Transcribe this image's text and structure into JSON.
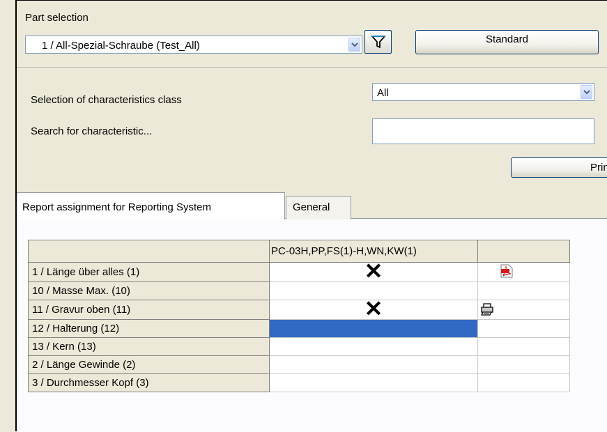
{
  "part_selection": {
    "label": "Part selection",
    "value": "1 / All-Spezial-Schraube (Test_All)",
    "standard_button": "Standard"
  },
  "filters": {
    "class_label": "Selection of characteristics class",
    "class_value": "All",
    "search_label": "Search for characteristic...",
    "search_value": "",
    "print_button": "Prin"
  },
  "tabs": [
    {
      "label": "Report assignment for Reporting System",
      "active": true
    },
    {
      "label": "General",
      "active": false
    }
  ],
  "grid": {
    "columns": [
      "",
      "PC-03H,PP,FS(1)-H,WN,KW(1)",
      ""
    ],
    "rows": [
      {
        "name": "1 / Länge über alles (1)",
        "mark": "✕",
        "icon": "pdf-icon"
      },
      {
        "name": "10 / Masse Max. (10)",
        "mark": "",
        "icon": ""
      },
      {
        "name": "11 / Gravur oben (11)",
        "mark": "✕",
        "icon": "printer-icon"
      },
      {
        "name": "12 / Halterung (12)",
        "mark": "",
        "icon": "",
        "selected": true
      },
      {
        "name": "13 / Kern (13)",
        "mark": "",
        "icon": ""
      },
      {
        "name": "2 / Länge Gewinde (2)",
        "mark": "",
        "icon": ""
      },
      {
        "name": "3 / Durchmesser Kopf (3)",
        "mark": "",
        "icon": ""
      }
    ]
  },
  "colors": {
    "window_bg": "#ece9d8",
    "selection": "#316ac5",
    "input_border": "#7f9db9"
  }
}
